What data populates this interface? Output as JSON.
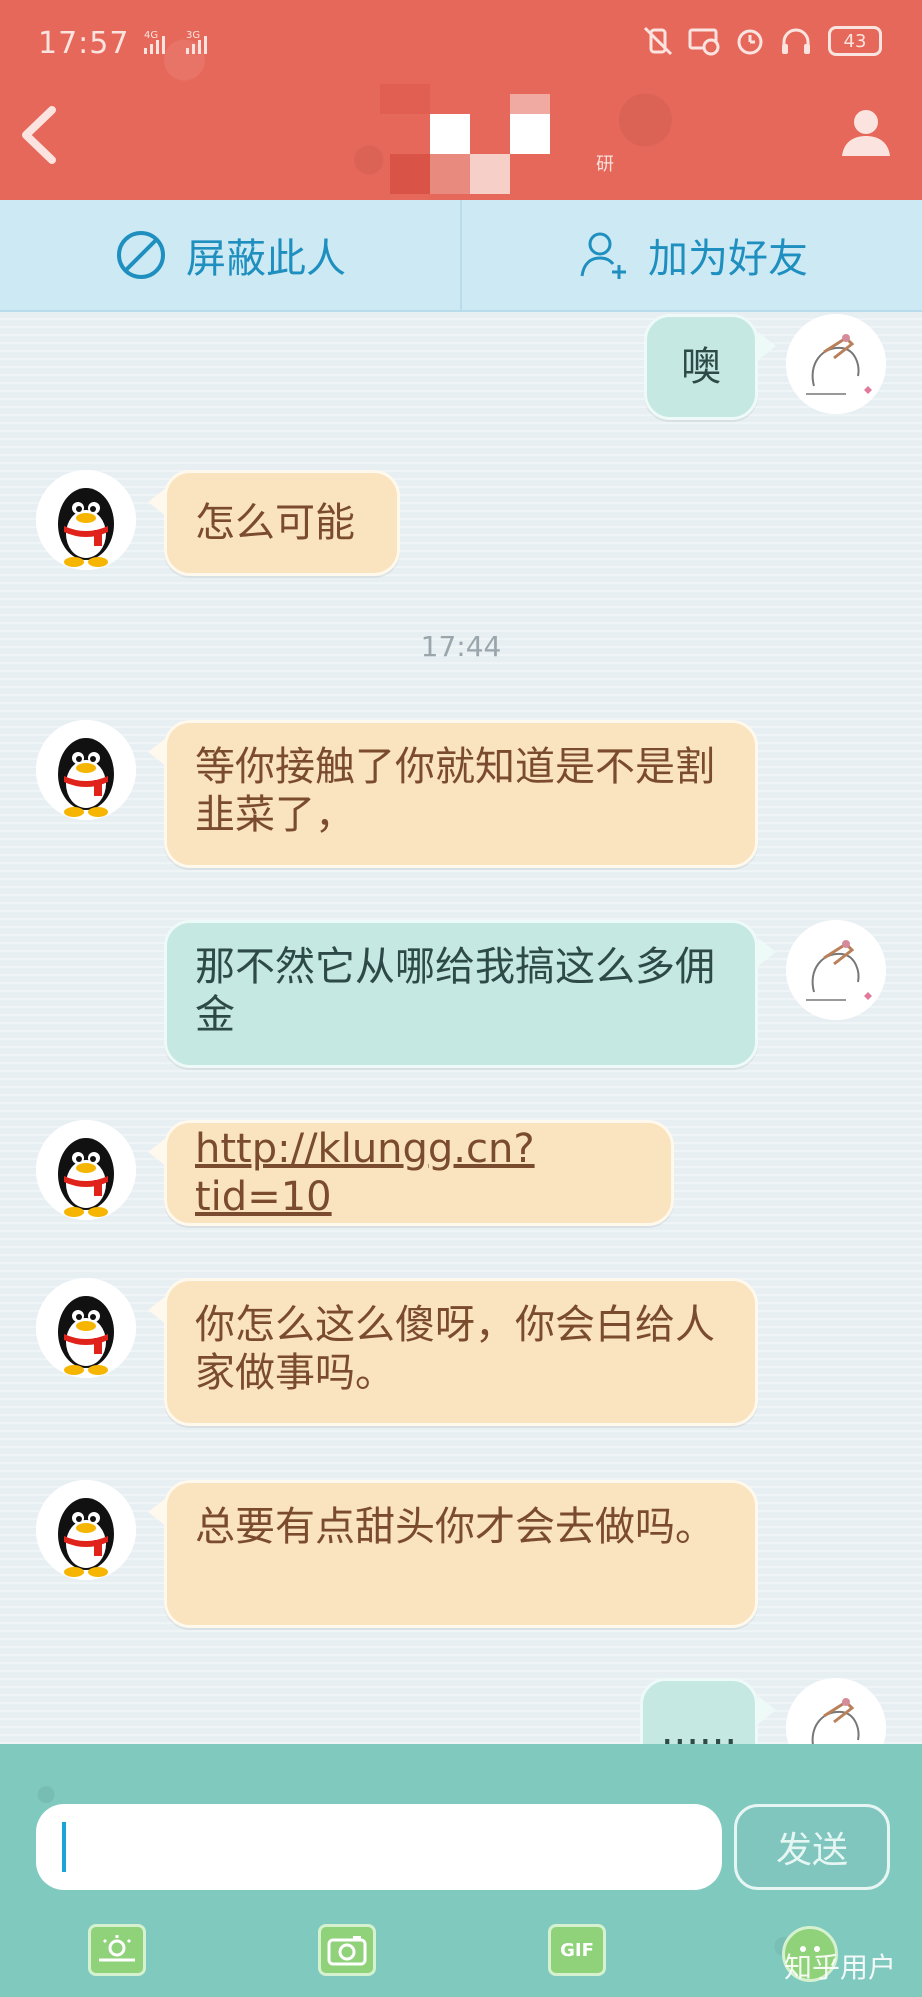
{
  "status_bar": {
    "time": "17:57",
    "network1": "4G",
    "network2": "3G",
    "battery": "43"
  },
  "header": {
    "title_suffix": "研"
  },
  "action_bar": {
    "block_label": "屏蔽此人",
    "add_friend_label": "加为好友"
  },
  "messages": [
    {
      "side": "out",
      "text": "噢"
    },
    {
      "side": "in",
      "text": "怎么可能"
    },
    {
      "timestamp": "17:44"
    },
    {
      "side": "in",
      "text": "等你接触了你就知道是不是割韭菜了，"
    },
    {
      "side": "out",
      "text": "那不然它从哪给我搞这么多佣金"
    },
    {
      "side": "in",
      "text": "http://klungg.cn?tid=10"
    },
    {
      "side": "in",
      "text": "你怎么这么傻呀，你会白给人家做事吗。"
    },
    {
      "side": "in",
      "text": "总要有点甜头你才会去做吗。"
    },
    {
      "side": "out",
      "text": "......"
    }
  ],
  "input": {
    "value": "",
    "send_label": "发送"
  },
  "toolbar": {
    "gif_label": "GIF"
  },
  "watermark": "知乎用户",
  "colors": {
    "header": "#e6685a",
    "incoming_bubble": "#fae3bf",
    "outgoing_bubble": "#c5e8e2",
    "accent": "#1f8fbf",
    "bottom_bar": "#7fc9bf"
  }
}
